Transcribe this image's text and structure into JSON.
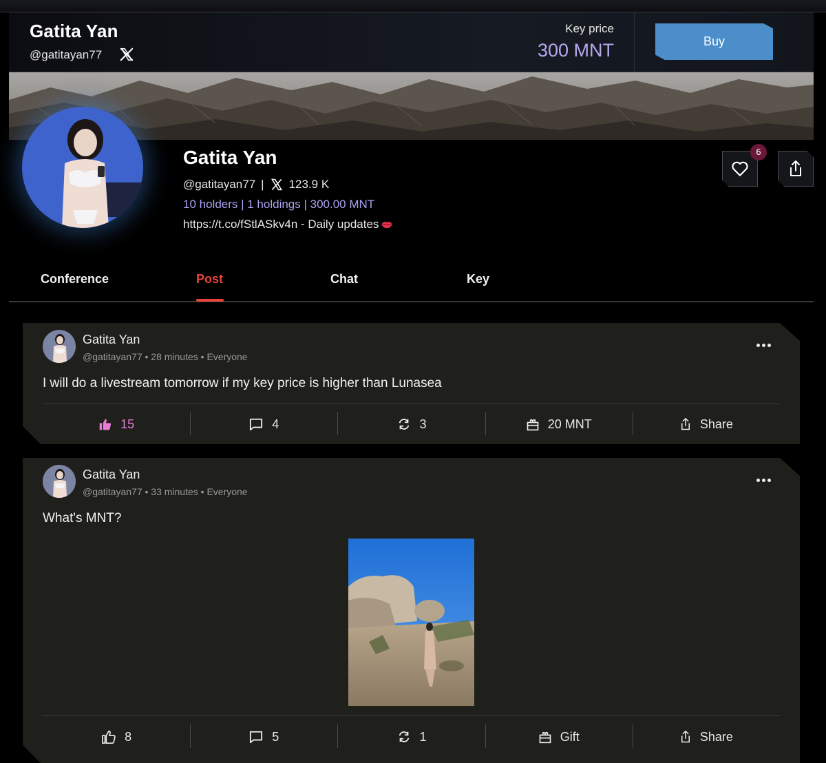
{
  "header": {
    "name": "Gatita Yan",
    "handle": "@gatitayan77",
    "key_price_label": "Key price",
    "key_price_value": "300 MNT",
    "buy_label": "Buy"
  },
  "profile": {
    "name": "Gatita Yan",
    "handle": "@gatitayan77",
    "separator": "|",
    "followers": "123.9 K",
    "stats": "10 holders | 1 holdings | 300.00 MNT",
    "bio": "https://t.co/fStlASkv4n - Daily updates",
    "like_count": "6"
  },
  "tabs": [
    {
      "label": "Conference"
    },
    {
      "label": "Post"
    },
    {
      "label": "Chat"
    },
    {
      "label": "Key"
    }
  ],
  "posts": [
    {
      "author": "Gatita Yan",
      "meta": "@gatitayan77 • 28 minutes • Everyone",
      "text": "I will do a livestream tomorrow if my key price is higher than Lunasea",
      "likes": "15",
      "comments": "4",
      "reposts": "3",
      "gift": "20 MNT",
      "share": "Share"
    },
    {
      "author": "Gatita Yan",
      "meta": "@gatitayan77 • 33 minutes • Everyone",
      "text": "What's MNT?",
      "likes": "8",
      "comments": "5",
      "reposts": "1",
      "gift": "Gift",
      "share": "Share"
    }
  ],
  "colors": {
    "accent_red": "#e8433b",
    "price_purple": "#b6a8ee",
    "buy_blue": "#4b8ec9",
    "liked_pink": "#e87ad8"
  }
}
